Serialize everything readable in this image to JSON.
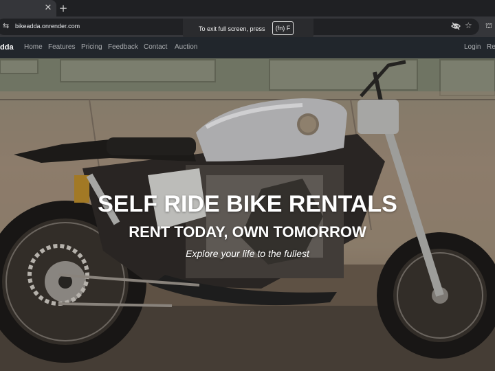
{
  "browser": {
    "tab_close_icon": "✕",
    "new_tab_icon": "+",
    "url": "bikeadda.onrender.com",
    "site_settings_icon": "⇆",
    "star_icon": "☆",
    "extension_icon": "⛫",
    "fullscreen_tip": {
      "text": "To exit full screen, press",
      "key": "(fn) F"
    }
  },
  "navbar": {
    "brand": "dda",
    "links": [
      "Home",
      "Features",
      "Pricing",
      "Feedback",
      "Contact",
      "Auction"
    ],
    "right_links": [
      "Login",
      "Re"
    ]
  },
  "hero": {
    "title": "SELF RIDE BIKE RENTALS",
    "subtitle": "RENT TODAY, OWN TOMORROW",
    "tagline": "Explore your life to the fullest"
  },
  "colors": {
    "tab_bg": "#35363a",
    "navbar_bg": "#21262c",
    "nav_link": "#a9acaf",
    "hero_text": "#ffffff"
  }
}
